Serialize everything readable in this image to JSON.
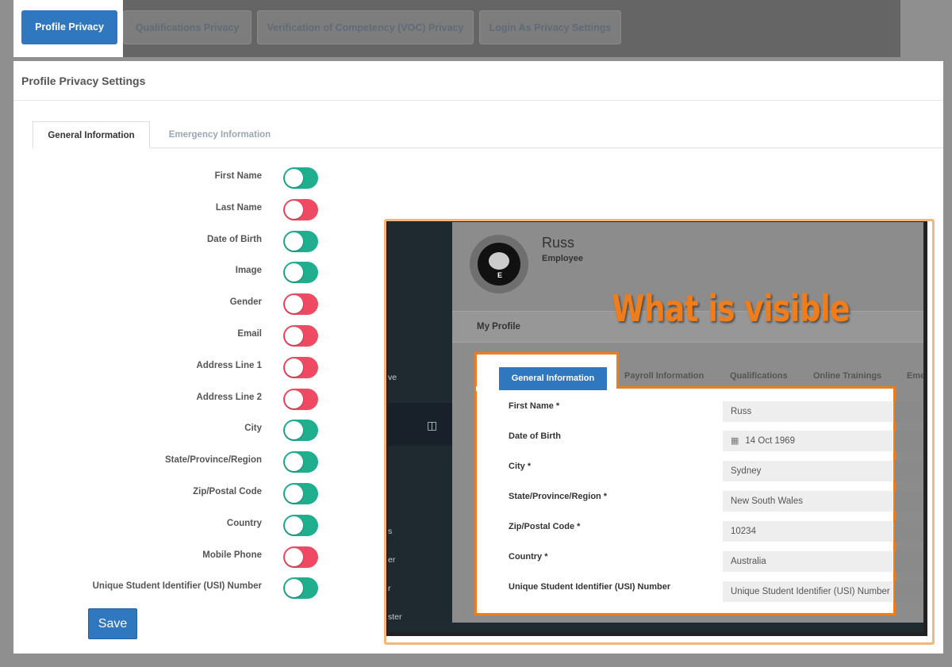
{
  "top_tabs": {
    "active": "Profile Privacy",
    "others": [
      "Qualifications Privacy",
      "Verification of Competency (VOC) Privacy",
      "Login As Privacy Settings"
    ]
  },
  "panel": {
    "title": "Profile Privacy Settings",
    "tabs": [
      "General Information",
      "Emergency Information"
    ]
  },
  "fields": [
    {
      "label": "First Name",
      "state": "on"
    },
    {
      "label": "Last Name",
      "state": "off"
    },
    {
      "label": "Date of Birth",
      "state": "on"
    },
    {
      "label": "Image",
      "state": "on"
    },
    {
      "label": "Gender",
      "state": "off"
    },
    {
      "label": "Email",
      "state": "off"
    },
    {
      "label": "Address Line 1",
      "state": "off"
    },
    {
      "label": "Address Line 2",
      "state": "off"
    },
    {
      "label": "City",
      "state": "on"
    },
    {
      "label": "State/Province/Region",
      "state": "on"
    },
    {
      "label": "Zip/Postal Code",
      "state": "on"
    },
    {
      "label": "Country",
      "state": "on"
    },
    {
      "label": "Mobile Phone",
      "state": "off"
    },
    {
      "label": "Unique Student Identifier (USI) Number",
      "state": "on"
    }
  ],
  "save_label": "Save",
  "colors": {
    "toggle_on": "#1fae8e",
    "toggle_off": "#ee4a63",
    "accent": "#2f78c0",
    "highlight": "#f07d1a"
  },
  "preview": {
    "user_name": "Russ",
    "user_role": "Employee",
    "overlay_caption": "What is visible",
    "section_title": "My Profile",
    "sidebar_fragments": [
      "ve",
      "s",
      "er",
      "r",
      "ster"
    ],
    "tabs": [
      "General Information",
      "Payroll Information",
      "Qualifications",
      "Online Trainings",
      "Eme"
    ],
    "form": [
      {
        "label": "First Name *",
        "value": "Russ",
        "icon": ""
      },
      {
        "label": "Date of Birth",
        "value": "14 Oct 1969",
        "icon": "calendar-icon"
      },
      {
        "label": "City *",
        "value": "Sydney",
        "icon": ""
      },
      {
        "label": "State/Province/Region *",
        "value": "New South Wales",
        "icon": ""
      },
      {
        "label": "Zip/Postal Code *",
        "value": "10234",
        "icon": ""
      },
      {
        "label": "Country *",
        "value": "Australia",
        "icon": ""
      },
      {
        "label": "Unique Student Identifier (USI) Number",
        "value": "Unique Student Identifier (USI) Number",
        "icon": ""
      }
    ]
  }
}
